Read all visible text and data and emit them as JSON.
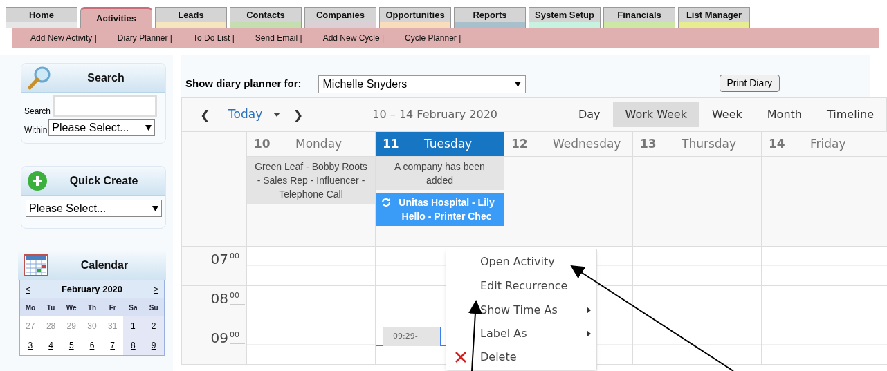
{
  "tabs": [
    {
      "label": "Home",
      "selected": false,
      "color": "#e6e6e6"
    },
    {
      "label": "Activities",
      "selected": true,
      "color": "#e0b0b0"
    },
    {
      "label": "Leads",
      "selected": false,
      "color": "#f6e6c0"
    },
    {
      "label": "Contacts",
      "selected": false,
      "color": "#c4deb0"
    },
    {
      "label": "Companies",
      "selected": false,
      "color": "#dcd0d6"
    },
    {
      "label": "Opportunities",
      "selected": false,
      "color": "#f8dcbc"
    },
    {
      "label": "Reports",
      "selected": false,
      "color": "#a8c0cc"
    },
    {
      "label": "System Setup",
      "selected": false,
      "color": "#c8f2e0"
    },
    {
      "label": "Financials",
      "selected": false,
      "color": "#cce8a4"
    },
    {
      "label": "List Manager",
      "selected": false,
      "color": "#e8ec90"
    }
  ],
  "subnav": [
    "Add New Activity |",
    "Diary Planner |",
    "To Do List |",
    "Send Email |",
    "Add New Cycle |",
    "Cycle Planner |"
  ],
  "search_panel": {
    "title": "Search",
    "search_label": "Search",
    "within_label": "Within",
    "within_value": "Please Select..."
  },
  "quick_create": {
    "title": "Quick Create",
    "value": "Please Select..."
  },
  "mini_calendar": {
    "title": "Calendar",
    "prev": "≤",
    "month": "February 2020",
    "next": "≥",
    "weekdays": [
      "Mo",
      "Tu",
      "We",
      "Th",
      "Fr",
      "Sa",
      "Su"
    ],
    "weeks": [
      [
        {
          "day": "27",
          "other_month": true
        },
        {
          "day": "28",
          "other_month": true
        },
        {
          "day": "29",
          "other_month": true
        },
        {
          "day": "30",
          "other_month": true
        },
        {
          "day": "31",
          "other_month": true
        },
        {
          "day": "1",
          "other_month": false
        },
        {
          "day": "2",
          "other_month": false
        }
      ],
      [
        {
          "day": "3",
          "other_month": false
        },
        {
          "day": "4",
          "other_month": false
        },
        {
          "day": "5",
          "other_month": false
        },
        {
          "day": "6",
          "other_month": false
        },
        {
          "day": "7",
          "other_month": false
        },
        {
          "day": "8",
          "other_month": false
        },
        {
          "day": "9",
          "other_month": false
        }
      ]
    ]
  },
  "planner": {
    "label": "Show diary planner for:",
    "user": "Michelle Snyders",
    "print_button": "Print Diary"
  },
  "toolbar": {
    "prev": "❮",
    "today": "Today",
    "next": "❯",
    "range": "10 – 14 February 2020",
    "views": [
      {
        "label": "Day",
        "selected": false
      },
      {
        "label": "Work Week",
        "selected": true
      },
      {
        "label": "Week",
        "selected": false
      },
      {
        "label": "Month",
        "selected": false
      },
      {
        "label": "Timeline",
        "selected": false
      }
    ]
  },
  "days": [
    {
      "number": "10",
      "name": "Monday",
      "selected": false,
      "events": [
        {
          "text": "Green Leaf - Bobby Roots - Sales Rep - Influencer - Telephone Call",
          "kind": "plain"
        }
      ]
    },
    {
      "number": "11",
      "name": "Tuesday",
      "selected": true,
      "events": [
        {
          "text": "A company has been added",
          "kind": "plain"
        },
        {
          "text": "Unitas Hospital - Lily Hello - Printer Chec",
          "kind": "recurring"
        }
      ]
    },
    {
      "number": "12",
      "name": "Wednesday",
      "selected": false
    },
    {
      "number": "13",
      "name": "Thursday",
      "selected": false
    },
    {
      "number": "14",
      "name": "Friday",
      "selected": false
    }
  ],
  "hours": [
    {
      "hour": "07",
      "minute": "00"
    },
    {
      "hour": "08",
      "minute": "00"
    },
    {
      "hour": "09",
      "minute": "00"
    }
  ],
  "timed_event": {
    "text": "09:29-"
  },
  "context_menu": [
    {
      "label": "Open Activity",
      "submenu": false,
      "kind": "plain",
      "divider_after": true
    },
    {
      "label": "Edit Recurrence",
      "submenu": false,
      "kind": "plain",
      "divider_after": true
    },
    {
      "label": "Show Time As",
      "submenu": true,
      "kind": "plain",
      "divider_after": false
    },
    {
      "label": "Label As",
      "submenu": true,
      "kind": "plain",
      "divider_after": false
    },
    {
      "label": "Delete",
      "submenu": false,
      "kind": "delete",
      "divider_after": false
    }
  ]
}
